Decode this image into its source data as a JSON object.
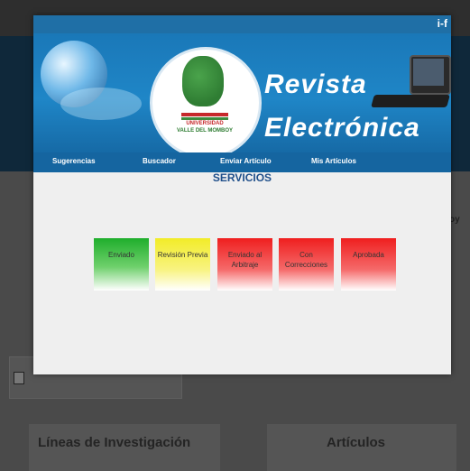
{
  "modal": {
    "close_symbol": "i-f"
  },
  "header": {
    "title_line1": "Revista",
    "title_line2": "Electrónica",
    "logo_line1": "UNIVERSIDAD",
    "logo_line2": "VALLE DEL MOMBOY"
  },
  "nav": {
    "items": [
      {
        "label": "Sugerencias"
      },
      {
        "label": "Buscador"
      },
      {
        "label": "Enviar Artículo"
      },
      {
        "label": "Mis Artículos"
      }
    ]
  },
  "main": {
    "heading": "SERVICIOS",
    "status_cards": [
      {
        "label": "Enviado",
        "color": "#1fae2c"
      },
      {
        "label": "Revisión Previa",
        "color": "#f2ec28"
      },
      {
        "label": "Enviado al Arbitraje",
        "color": "#ef1f1f"
      },
      {
        "label": "Con Correcciones",
        "color": "#ef1f1f"
      },
      {
        "label": "Aprobada",
        "color": "#ef1f1f"
      }
    ]
  },
  "background": {
    "section_left": "Líneas de Investigación",
    "section_right": "Artículos",
    "side_fragment": "oy"
  }
}
